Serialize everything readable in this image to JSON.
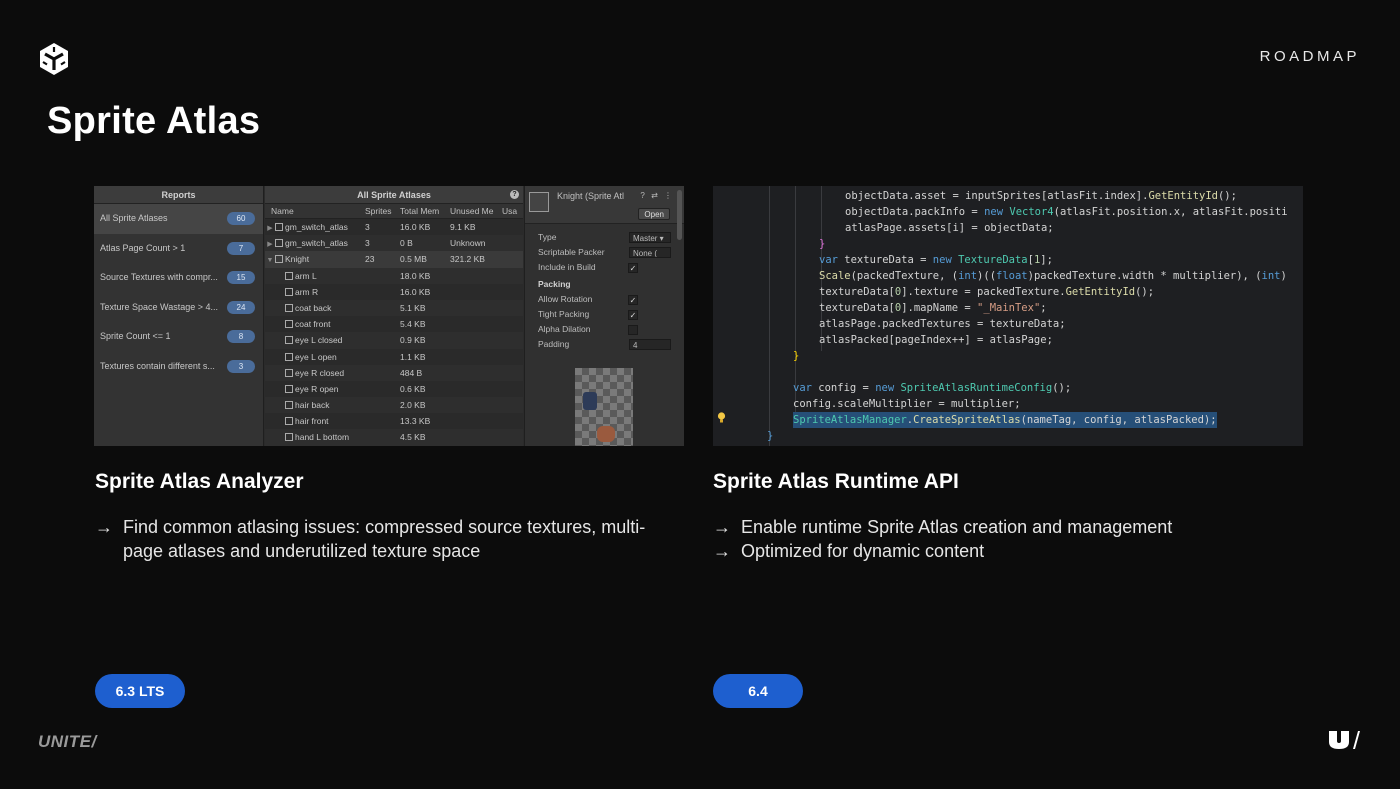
{
  "header": {
    "logo_icon": "unity-cube-icon",
    "section_label": "ROADMAP",
    "title": "Sprite Atlas"
  },
  "analyzer_shot": {
    "reports_header": "Reports",
    "reports": [
      {
        "label": "All Sprite Atlases",
        "count": "60",
        "selected": true
      },
      {
        "label": "Atlas Page Count > 1",
        "count": "7"
      },
      {
        "label": "Source Textures with compr...",
        "count": "15"
      },
      {
        "label": "Texture Space Wastage > 4...",
        "count": "24"
      },
      {
        "label": "Sprite Count <= 1",
        "count": "8"
      },
      {
        "label": "Textures contain different s...",
        "count": "3"
      }
    ],
    "table_header": "All Sprite Atlases",
    "columns": [
      "Name",
      "Sprites",
      "Total Mem",
      "Unused Me",
      "Usa"
    ],
    "rows": [
      {
        "name": "gm_switch_atlas",
        "sprites": "3",
        "total": "16.0 KB",
        "unused": "9.1 KB",
        "level": 0,
        "expand": "▶"
      },
      {
        "name": "gm_switch_atlas",
        "sprites": "3",
        "total": "0 B",
        "unused": "Unknown",
        "level": 0,
        "expand": "▶"
      },
      {
        "name": "Knight",
        "sprites": "23",
        "total": "0.5 MB",
        "unused": "321.2 KB",
        "level": 0,
        "expand": "▼",
        "selected": true
      },
      {
        "name": "arm L",
        "sprites": "",
        "total": "18.0 KB",
        "unused": "",
        "level": 1
      },
      {
        "name": "arm R",
        "sprites": "",
        "total": "16.0 KB",
        "unused": "",
        "level": 1
      },
      {
        "name": "coat back",
        "sprites": "",
        "total": "5.1 KB",
        "unused": "",
        "level": 1
      },
      {
        "name": "coat front",
        "sprites": "",
        "total": "5.4 KB",
        "unused": "",
        "level": 1
      },
      {
        "name": "eye L closed",
        "sprites": "",
        "total": "0.9 KB",
        "unused": "",
        "level": 1
      },
      {
        "name": "eye L open",
        "sprites": "",
        "total": "1.1 KB",
        "unused": "",
        "level": 1
      },
      {
        "name": "eye R closed",
        "sprites": "",
        "total": "484 B",
        "unused": "",
        "level": 1
      },
      {
        "name": "eye R open",
        "sprites": "",
        "total": "0.6 KB",
        "unused": "",
        "level": 1
      },
      {
        "name": "hair back",
        "sprites": "",
        "total": "2.0 KB",
        "unused": "",
        "level": 1
      },
      {
        "name": "hair front",
        "sprites": "",
        "total": "13.3 KB",
        "unused": "",
        "level": 1
      },
      {
        "name": "hand L bottom",
        "sprites": "",
        "total": "4.5 KB",
        "unused": "",
        "level": 1
      }
    ],
    "inspector": {
      "title": "Knight (Sprite Atl",
      "open_label": "Open",
      "props": [
        {
          "label": "Type",
          "value": "Master ▾",
          "kind": "select"
        },
        {
          "label": "Scriptable Packer",
          "value": "None (",
          "kind": "select"
        },
        {
          "label": "Include in Build",
          "value": "✓",
          "kind": "check"
        },
        {
          "label": "Packing",
          "kind": "header"
        },
        {
          "label": "Allow Rotation",
          "value": "✓",
          "kind": "check"
        },
        {
          "label": "Tight Packing",
          "value": "✓",
          "kind": "check"
        },
        {
          "label": "Alpha Dilation",
          "value": "",
          "kind": "check"
        },
        {
          "label": "Padding",
          "value": "4",
          "kind": "select"
        }
      ]
    }
  },
  "code_shot": {
    "lines": [
      "objectData.asset = inputSprites[atlasFit.index].GetEntityId();",
      "objectData.packInfo = new Vector4(atlasFit.position.x, atlasFit.positi",
      "atlasPage.assets[i] = objectData;",
      "}",
      "var textureData = new TextureData[1];",
      "Scale(packedTexture, (int)((float)packedTexture.width * multiplier), (int)",
      "textureData[0].texture = packedTexture.GetEntityId();",
      "textureData[0].mapName = \"_MainTex\";",
      "atlasPage.packedTextures = textureData;",
      "atlasPacked[pageIndex++] = atlasPage;",
      "}",
      "",
      "var config = new SpriteAtlasRuntimeConfig();",
      "config.scaleMultiplier = multiplier;",
      "SpriteAtlasManager.CreateSpriteAtlas(nameTag, config, atlasPacked);",
      "}"
    ]
  },
  "left_feature": {
    "title": "Sprite Atlas Analyzer",
    "bullets": [
      "Find common atlasing issues: compressed source textures, multi-page atlases and underutilized texture space"
    ],
    "version": "6.3 LTS"
  },
  "right_feature": {
    "title": "Sprite Atlas Runtime API",
    "bullets": [
      "Enable runtime Sprite Atlas creation and management",
      "Optimized for dynamic content"
    ],
    "version": "6.4"
  },
  "footer": {
    "brand": "UNITE/",
    "logo_icon": "unite-u-logo-icon"
  },
  "colors": {
    "background": "#0c0c0c",
    "pill": "#1e5fcf",
    "code_bg": "#1e1f22",
    "highlight": "#264f78"
  }
}
